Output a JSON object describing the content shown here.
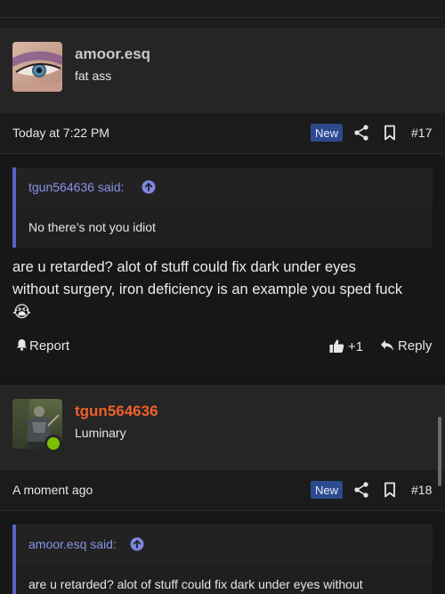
{
  "posts": [
    {
      "username": "amoor.esq",
      "user_title": "fat ass",
      "avatar": "eye-closeup-avatar",
      "date": "Today at 7:22 PM",
      "badge": "New",
      "post_number": "#17",
      "quote": {
        "author_label": "tgun564636 said:",
        "text": "No there’s not you idiot"
      },
      "body_line1": "are u retarded? alot of stuff could fix dark under eyes",
      "body_line2": "without surgery, iron deficiency is an example you sped fuck",
      "body_emoji": "😭",
      "actions": {
        "report": "Report",
        "like_count": "+1",
        "reply": "Reply"
      }
    },
    {
      "username": "tgun564636",
      "username_color": "#f0602a",
      "user_title": "Luminary",
      "avatar": "armored-figure-avatar",
      "online": true,
      "date": "A moment ago",
      "badge": "New",
      "post_number": "#18",
      "quote": {
        "author_label": "amoor.esq said:",
        "text": "are u retarded? alot of stuff could fix dark under eyes without"
      }
    }
  ],
  "colors": {
    "accent": "#5762c8",
    "badge_bg": "#2c4a8c",
    "online": "#7bc100",
    "username_default": "#c8c8c8"
  }
}
